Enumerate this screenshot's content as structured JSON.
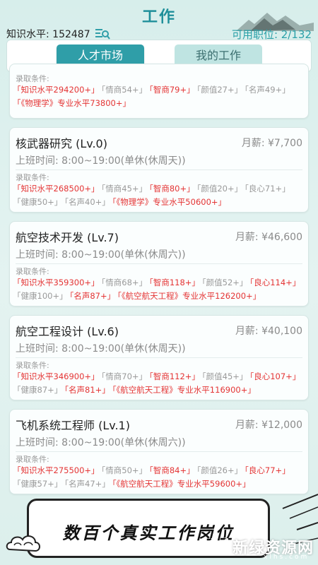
{
  "header": {
    "title": "工作",
    "knowledge_label": "知识水平: 152487",
    "positions_label": "可用职位: 2/132"
  },
  "tabs": [
    {
      "label": "人才市场",
      "active": true
    },
    {
      "label": "我的工作",
      "active": false
    }
  ],
  "jobs": [
    {
      "name": "",
      "salary": "",
      "hours": "",
      "req_label": "录取条件:",
      "lines": [
        [
          {
            "text": "「知识水平294200+」",
            "met": false
          },
          {
            "text": "「情商54+」",
            "met": true
          },
          {
            "text": "「智商79+」",
            "met": false
          },
          {
            "text": "「颜值27+」",
            "met": true
          },
          {
            "text": "「名声49+」",
            "met": true
          }
        ],
        [
          {
            "text": "「《物理学》专业水平73800+」",
            "met": false
          }
        ]
      ]
    },
    {
      "name": "核武器研究 (Lv.0)",
      "salary": "月薪: ¥7,700",
      "hours": "上班时间: 8:00~19:00(单休(休周天))",
      "req_label": "录取条件:",
      "lines": [
        [
          {
            "text": "「知识水平268500+」",
            "met": false
          },
          {
            "text": "「情商45+」",
            "met": true
          },
          {
            "text": "「智商80+」",
            "met": false
          },
          {
            "text": "「颜值20+」",
            "met": true
          },
          {
            "text": "「良心71+」",
            "met": true
          }
        ],
        [
          {
            "text": "「健康50+」",
            "met": true
          },
          {
            "text": "「名声40+」",
            "met": true
          },
          {
            "text": "「《物理学》专业水平50600+」",
            "met": false
          }
        ]
      ]
    },
    {
      "name": "航空技术开发 (Lv.7)",
      "salary": "月薪: ¥46,600",
      "hours": "上班时间: 8:00~19:00(单休(休周六))",
      "req_label": "录取条件:",
      "lines": [
        [
          {
            "text": "「知识水平359300+」",
            "met": false
          },
          {
            "text": "「情商68+」",
            "met": true
          },
          {
            "text": "「智商118+」",
            "met": false
          },
          {
            "text": "「颜值52+」",
            "met": true
          },
          {
            "text": "「良心114+」",
            "met": false
          }
        ],
        [
          {
            "text": "「健康100+」",
            "met": true
          },
          {
            "text": "「名声87+」",
            "met": false
          },
          {
            "text": "「《航空航天工程》专业水平126200+」",
            "met": false
          }
        ]
      ]
    },
    {
      "name": "航空工程设计 (Lv.6)",
      "salary": "月薪: ¥40,100",
      "hours": "上班时间: 8:00~19:00(单休(休周天))",
      "req_label": "录取条件:",
      "lines": [
        [
          {
            "text": "「知识水平346900+」",
            "met": false
          },
          {
            "text": "「情商70+」",
            "met": true
          },
          {
            "text": "「智商112+」",
            "met": false
          },
          {
            "text": "「颜值45+」",
            "met": true
          },
          {
            "text": "「良心107+」",
            "met": false
          }
        ],
        [
          {
            "text": "「健康87+」",
            "met": true
          },
          {
            "text": "「名声81+」",
            "met": false
          },
          {
            "text": "「《航空航天工程》专业水平116900+」",
            "met": false
          }
        ]
      ]
    },
    {
      "name": "飞机系统工程师 (Lv.1)",
      "salary": "月薪: ¥12,000",
      "hours": "上班时间: 8:00~19:00(单休(休周六))",
      "req_label": "录取条件:",
      "lines": [
        [
          {
            "text": "「知识水平275500+」",
            "met": false
          },
          {
            "text": "「情商50+」",
            "met": true
          },
          {
            "text": "「智商84+」",
            "met": false
          },
          {
            "text": "「颜值26+」",
            "met": true
          },
          {
            "text": "「良心77+」",
            "met": false
          }
        ],
        [
          {
            "text": "「健康57+」",
            "met": true
          },
          {
            "text": "「名声47+」",
            "met": true
          },
          {
            "text": "「《航空航天工程》专业水平59600+」",
            "met": false
          }
        ]
      ]
    }
  ],
  "banner": {
    "text": "数百个真实工作岗位"
  },
  "watermark": {
    "text": "新绿资源网",
    "sub": "xlhs.com"
  },
  "colors": {
    "accent": "#2f9ea8",
    "requirement_unmet": "#e43434",
    "requirement_met": "#9a9a9a"
  }
}
